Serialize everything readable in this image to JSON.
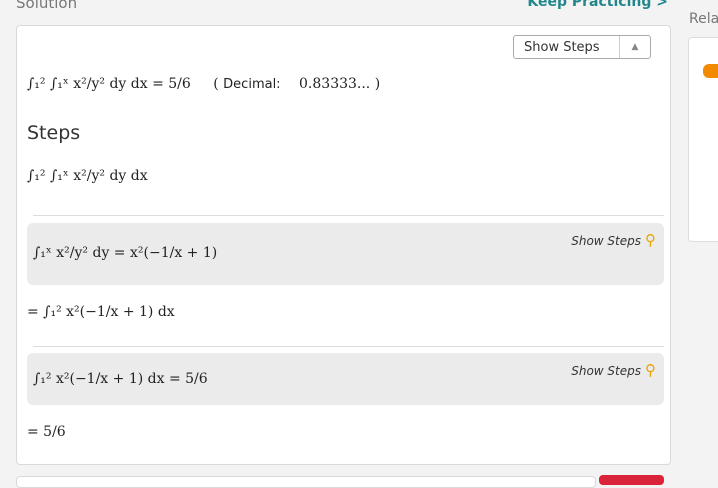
{
  "header": {
    "title": "Solution",
    "keep_practicing": "Keep Practicing >"
  },
  "sidebar": {
    "related": "Rela"
  },
  "controls": {
    "show_steps_select": "Show Steps"
  },
  "result": {
    "expression": "∫₁² ∫₁ˣ x²/y² dy dx = 5/6",
    "decimal_label": "Decimal:",
    "decimal_value": "0.83333..."
  },
  "steps": {
    "title": "Steps",
    "expression": "∫₁² ∫₁ˣ x²/y² dy dx",
    "items": [
      {
        "math": "∫₁ˣ x²/y² dy = x²(−1/x + 1)",
        "link": "Show Steps"
      },
      {
        "math": "= ∫₁² x²(−1/x + 1) dx"
      },
      {
        "math": "∫₁² x²(−1/x + 1) dx = 5/6",
        "link": "Show Steps"
      },
      {
        "math": "= 5/6"
      }
    ]
  },
  "colors": {
    "accent": "#22878d",
    "key_icon": "#e8a400",
    "step_bg": "#ebebeb"
  },
  "icons": {
    "key": "key-icon",
    "select_arrows": "chevron-up-down-icon",
    "blogger": "blogger-icon"
  }
}
